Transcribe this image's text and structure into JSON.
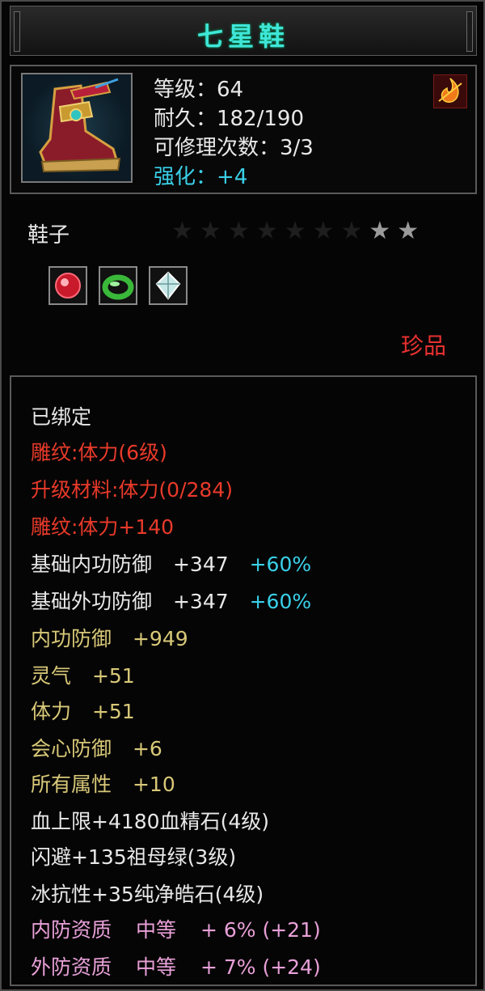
{
  "title": "七星鞋",
  "header": {
    "level_label": "等级：64",
    "durability_label": "耐久：182/190",
    "repair_label": "可修理次数：3/3",
    "enhance_label": "强化：+4"
  },
  "item": {
    "slot": "鞋子",
    "stars_total": 9,
    "stars_lit": 2,
    "gems": [
      "red-gem-icon",
      "green-jade-ring-icon",
      "white-diamond-icon"
    ],
    "quality": "珍品"
  },
  "attrs": {
    "bound": "已绑定",
    "engrave": "雕纹:体力(6级)",
    "upgrade": "升级材料:体力(0/284)",
    "engrave_bonus": "雕纹:体力+140",
    "base_inner_def": "基础内功防御",
    "base_inner_def_val": "+347",
    "base_inner_def_pct": "+60%",
    "base_outer_def": "基础外功防御",
    "base_outer_def_val": "+347",
    "base_outer_def_pct": "+60%",
    "inner_def": "内功防御",
    "inner_def_val": "+949",
    "spirit": "灵气",
    "spirit_val": "+51",
    "stamina": "体力",
    "stamina_val": "+51",
    "crit_def": "会心防御",
    "crit_def_val": "+6",
    "all_attr": "所有属性",
    "all_attr_val": "+10",
    "hp_cap": "血上限+4180血精石(4级)",
    "dodge": "闪避+135祖母绿(3级)",
    "ice_res": "冰抗性+35纯净皓石(4级)",
    "inner_quality": "内防资质",
    "inner_quality_grade": "中等",
    "inner_quality_val": "+  6% (+21)",
    "outer_quality": "外防资质",
    "outer_quality_grade": "中等",
    "outer_quality_val": "+  7% (+24)"
  },
  "colors": {
    "title": "#3fe6d8",
    "enhance": "#39d0e8",
    "engrave": "#e83a2a",
    "yellow_attr": "#d8c878",
    "quality_attr": "#e8a0d8",
    "quality_tag": "#e83030"
  }
}
